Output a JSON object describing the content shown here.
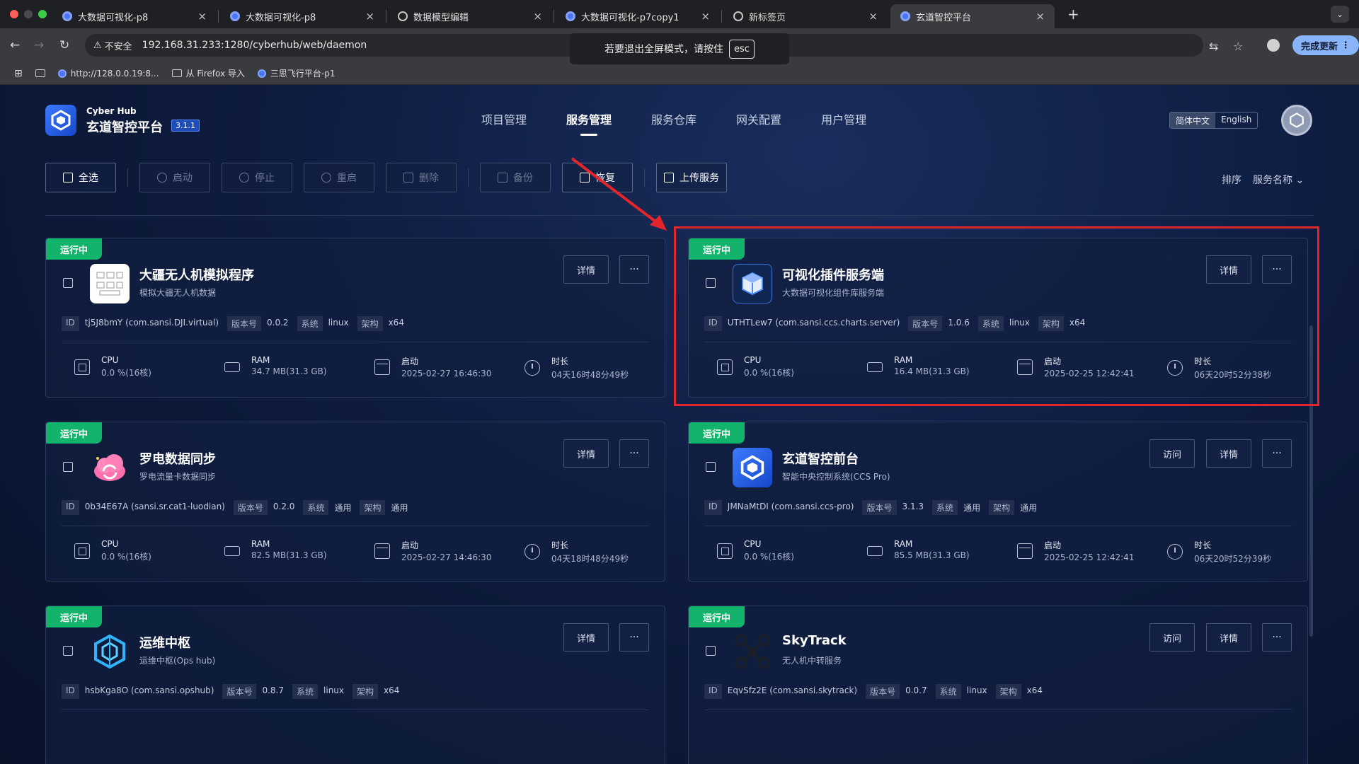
{
  "browser": {
    "tabs": [
      {
        "title": "大数据可视化-p8"
      },
      {
        "title": "大数据可视化-p8"
      },
      {
        "title": "数据模型编辑"
      },
      {
        "title": "大数据可视化-p7copy1"
      },
      {
        "title": "新标签页"
      },
      {
        "title": "玄道智控平台"
      }
    ],
    "insecure_label": "不安全",
    "url": "192.168.31.233:1280/cyberhub/web/daemon",
    "update_label": "完成更新",
    "fullscreen_notice": "若要退出全屏模式，请按住",
    "fullscreen_key": "esc",
    "bookmarks": [
      {
        "label": "http://128.0.0.19:8..."
      },
      {
        "label": "从 Firefox 导入"
      },
      {
        "label": "三思飞行平台-p1"
      }
    ]
  },
  "app": {
    "brand_small": "Cyber Hub",
    "brand_name": "玄道智控平台",
    "version": "3.1.1",
    "nav": [
      "项目管理",
      "服务管理",
      "服务仓库",
      "网关配置",
      "用户管理"
    ],
    "active_nav": "服务管理",
    "lang": {
      "zh": "简体中文",
      "en": "English"
    },
    "toolbar": {
      "select_all": "全选",
      "start": "启动",
      "stop": "停止",
      "restart": "重启",
      "delete": "删除",
      "backup": "备份",
      "restore": "恢复",
      "upload": "上传服务"
    },
    "sort_label": "排序",
    "sort_value": "服务名称"
  },
  "card_labels": {
    "status": "运行中",
    "detail": "详情",
    "visit": "访问",
    "more": "···",
    "id": "ID",
    "version": "版本号",
    "os": "系统",
    "arch": "架构",
    "cpu": "CPU",
    "ram": "RAM",
    "start": "启动",
    "duration": "时长"
  },
  "services": [
    {
      "name": "大疆无人机模拟程序",
      "desc": "模拟大疆无人机数据",
      "id": "tj5J8bmY (com.sansi.DJI.virtual)",
      "version": "0.0.2",
      "os": "linux",
      "arch": "x64",
      "cpu": "0.0 %(16核)",
      "ram": "34.7 MB(31.3 GB)",
      "start": "2025-02-27 16:46:30",
      "duration": "04天16时48分49秒",
      "icon": "dji-thumbnail-icon"
    },
    {
      "name": "可视化插件服务端",
      "desc": "大数据可视化组件库服务端",
      "id": "UTHTLew7 (com.sansi.ccs.charts.server)",
      "version": "1.0.6",
      "os": "linux",
      "arch": "x64",
      "cpu": "0.0 %(16核)",
      "ram": "16.4 MB(31.3 GB)",
      "start": "2025-02-25 12:42:41",
      "duration": "06天20时52分38秒",
      "icon": "cube-plugin-icon"
    },
    {
      "name": "罗电数据同步",
      "desc": "罗电流量卡数据同步",
      "id": "0b34E67A (sansi.sr.cat1-luodian)",
      "version": "0.2.0",
      "os": "通用",
      "arch": "通用",
      "cpu": "0.0 %(16核)",
      "ram": "82.5 MB(31.3 GB)",
      "start": "2025-02-27 14:46:30",
      "duration": "04天18时48分49秒",
      "icon": "cloud-sync-icon"
    },
    {
      "name": "玄道智控前台",
      "desc": "智能中央控制系统(CCS Pro)",
      "id": "JMNaMtDI (com.sansi.ccs-pro)",
      "version": "3.1.3",
      "os": "通用",
      "arch": "通用",
      "cpu": "0.0 %(16核)",
      "ram": "85.5 MB(31.3 GB)",
      "start": "2025-02-25 12:42:41",
      "duration": "06天20时52分39秒",
      "icon": "hexagon-logo-icon"
    },
    {
      "name": "运维中枢",
      "desc": "运维中枢(Ops hub)",
      "id": "hsbKga8O (com.sansi.opshub)",
      "version": "0.8.7",
      "os": "linux",
      "arch": "x64",
      "icon": "ops-hexagon-icon"
    },
    {
      "name": "SkyTrack",
      "desc": "无人机中转服务",
      "id": "EqvSfz2E (com.sansi.skytrack)",
      "version": "0.0.7",
      "os": "linux",
      "arch": "x64",
      "icon": "drone-icon"
    }
  ]
}
